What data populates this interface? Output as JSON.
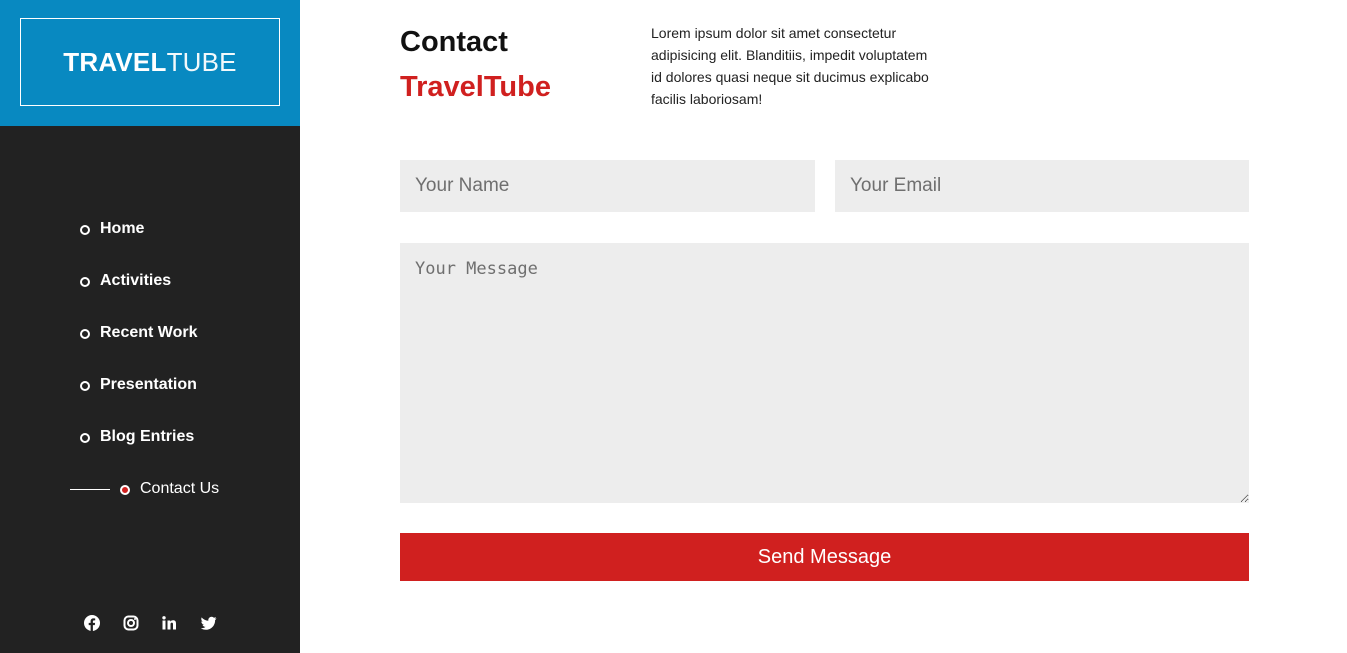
{
  "brand": {
    "bold": "TRAVEL",
    "light": "TUBE",
    "color": "#0889c1"
  },
  "nav": {
    "items": [
      {
        "label": "Home",
        "active": false
      },
      {
        "label": "Activities",
        "active": false
      },
      {
        "label": "Recent Work",
        "active": false
      },
      {
        "label": "Presentation",
        "active": false
      },
      {
        "label": "Blog Entries",
        "active": false
      },
      {
        "label": "Contact Us",
        "active": true
      }
    ]
  },
  "social": [
    "facebook-icon",
    "instagram-icon",
    "linkedin-icon",
    "twitter-icon"
  ],
  "heading": {
    "line1": "Contact",
    "line2": "TravelTube",
    "accent_color": "#d0201f"
  },
  "intro": "Lorem ipsum dolor sit amet consectetur adipisicing elit. Blanditiis, impedit voluptatem id dolores quasi neque sit ducimus explicabo facilis laboriosam!",
  "form": {
    "name_placeholder": "Your Name",
    "email_placeholder": "Your Email",
    "message_placeholder": "Your Message",
    "submit_label": "Send Message"
  },
  "colors": {
    "sidebar_bg": "#222222",
    "field_bg": "#ededed",
    "button_bg": "#d0201f"
  }
}
